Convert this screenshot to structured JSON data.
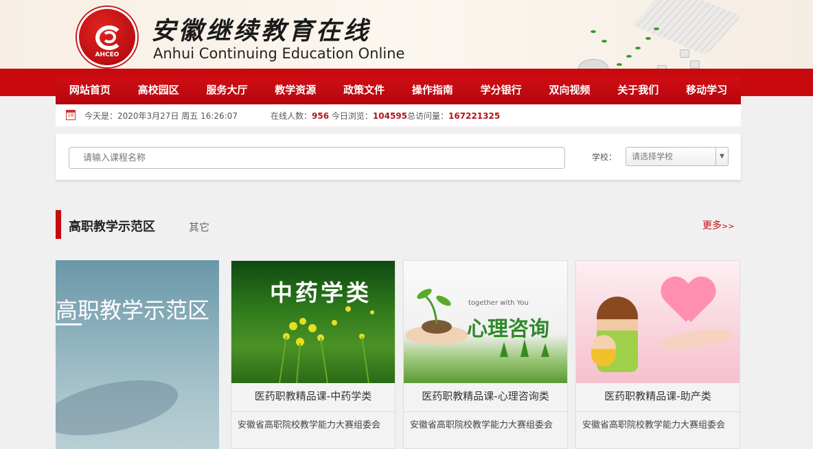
{
  "header": {
    "logo_text": "安徽继续教育网络园区",
    "logo_abbr": "AHCEO",
    "title_cn": "安徽继续教育在线",
    "title_en": "Anhui Continuing Education  Online"
  },
  "nav": {
    "items": [
      "网站首页",
      "高校园区",
      "服务大厅",
      "教学资源",
      "政策文件",
      "操作指南",
      "学分银行",
      "双向视频",
      "关于我们",
      "移动学习"
    ]
  },
  "info": {
    "date_text": "今天是：2020年3月27日 周五 16:26:07",
    "online_label": "在线人数：",
    "online_value": "956",
    "today_label": "今日浏览：",
    "today_value": "104595",
    "total_label": "总访问量：",
    "total_value": "167221325"
  },
  "search": {
    "placeholder": "请输入课程名称",
    "school_label": "学校：",
    "school_placeholder": "请选择学校"
  },
  "section": {
    "title": "高职教学示范区",
    "tab_other": "其它",
    "more": "更多",
    "more_arrows": ">>"
  },
  "feature": {
    "title": "高职教学示范区"
  },
  "courses": [
    {
      "image_text": "中药学类",
      "title": "医药职教精品课-中药学类",
      "org": "安徽省高职院校教学能力大赛组委会"
    },
    {
      "image_sub": "together with You",
      "image_text": "心理咨询",
      "title": "医药职教精品课-心理咨询类",
      "org": "安徽省高职院校教学能力大赛组委会"
    },
    {
      "title": "医药职教精品课-助产类",
      "org": "安徽省高职院校教学能力大赛组委会"
    }
  ],
  "colors": {
    "brand_red": "#c8090e",
    "stat_red": "#b41414"
  }
}
